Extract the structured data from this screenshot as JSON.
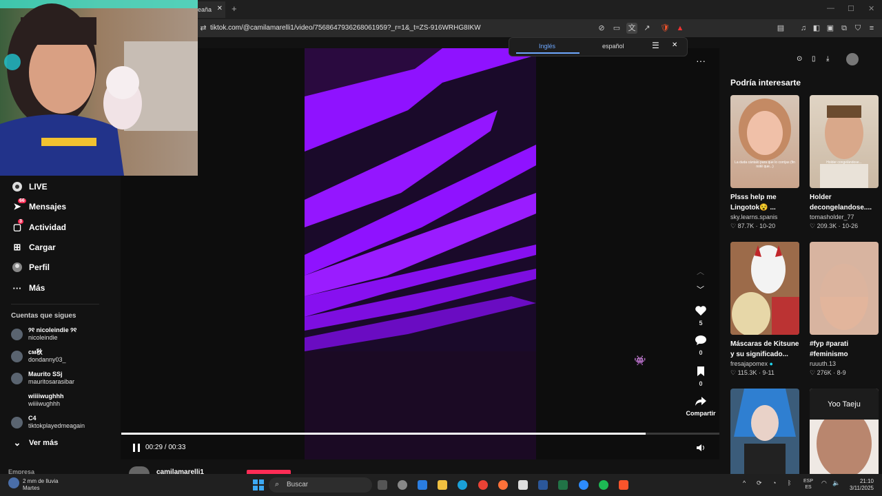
{
  "browser": {
    "tab_title": "eaña",
    "url": "tiktok.com/@camilamarelli1/video/7568647936268061959?_r=1&_t=ZS-916WRHG8IKW"
  },
  "translate_bar": {
    "source_lang": "Inglés",
    "target_lang": "español"
  },
  "sidebar": {
    "nav": [
      {
        "label": "LIVE",
        "icon": "live-icon"
      },
      {
        "label": "Mensajes",
        "icon": "send-icon",
        "badge": "66"
      },
      {
        "label": "Actividad",
        "icon": "activity-icon",
        "badge": "3"
      },
      {
        "label": "Cargar",
        "icon": "plus-icon"
      },
      {
        "label": "Perfil",
        "icon": "profile-icon"
      },
      {
        "label": "Más",
        "icon": "more-icon"
      }
    ],
    "following_title": "Cuentas que sigues",
    "following": [
      {
        "name": "୨୧ nicoleindie ୨୧",
        "handle": "nicoleindie"
      },
      {
        "name": "cм秋",
        "handle": "dondanny03_"
      },
      {
        "name": "Maurito SSj",
        "handle": "mauritosarasibar"
      },
      {
        "name": "wiiiiwughhh",
        "handle": "wiiiiwughhh"
      },
      {
        "name": "C4",
        "handle": "tiktokplayedmeagain"
      }
    ],
    "see_more": "Ver más",
    "footer": "Empresa"
  },
  "player": {
    "time": "00:29 / 00:33",
    "progress": 0.877,
    "author": "camilamarelli1",
    "actions": [
      {
        "name": "like",
        "count": "5"
      },
      {
        "name": "comment",
        "count": "0"
      },
      {
        "name": "bookmark",
        "count": "0"
      }
    ],
    "share_label": "Compartir"
  },
  "recommended": {
    "title": "Podría interesarte",
    "cards": [
      {
        "title": "Plsss help me Lingotok😵 ...",
        "user": "sky.learns.spanis",
        "views": "87.7K",
        "date": "10-20",
        "overlay": "La duda cántalo para que lo corrijas (fin noté que...)"
      },
      {
        "title": "Holder decongelandose....",
        "user": "tomasholder_77",
        "views": "209.3K",
        "date": "10-26",
        "overlay": "Holder congelándose..."
      },
      {
        "title": "Máscaras de Kitsune y su significado...",
        "user": "fresajapomex",
        "views": "115.3K",
        "date": "9-11",
        "overlay": ""
      },
      {
        "title": "#fyp #parati #feminismo",
        "user": "ruuuth.13",
        "views": "276K",
        "date": "8-9",
        "overlay": ""
      },
      {
        "title": "",
        "user": "",
        "views": "",
        "date": "",
        "overlay": ""
      },
      {
        "title": "",
        "user": "",
        "views": "",
        "date": "",
        "overlay": "Yoo Taeju"
      }
    ]
  },
  "taskbar": {
    "weather": "2 mm de lluvia",
    "day": "Martes",
    "search_placeholder": "Buscar",
    "lang": "ESP",
    "lang2": "ES",
    "time": "21:10",
    "date": "3/11/2025"
  }
}
